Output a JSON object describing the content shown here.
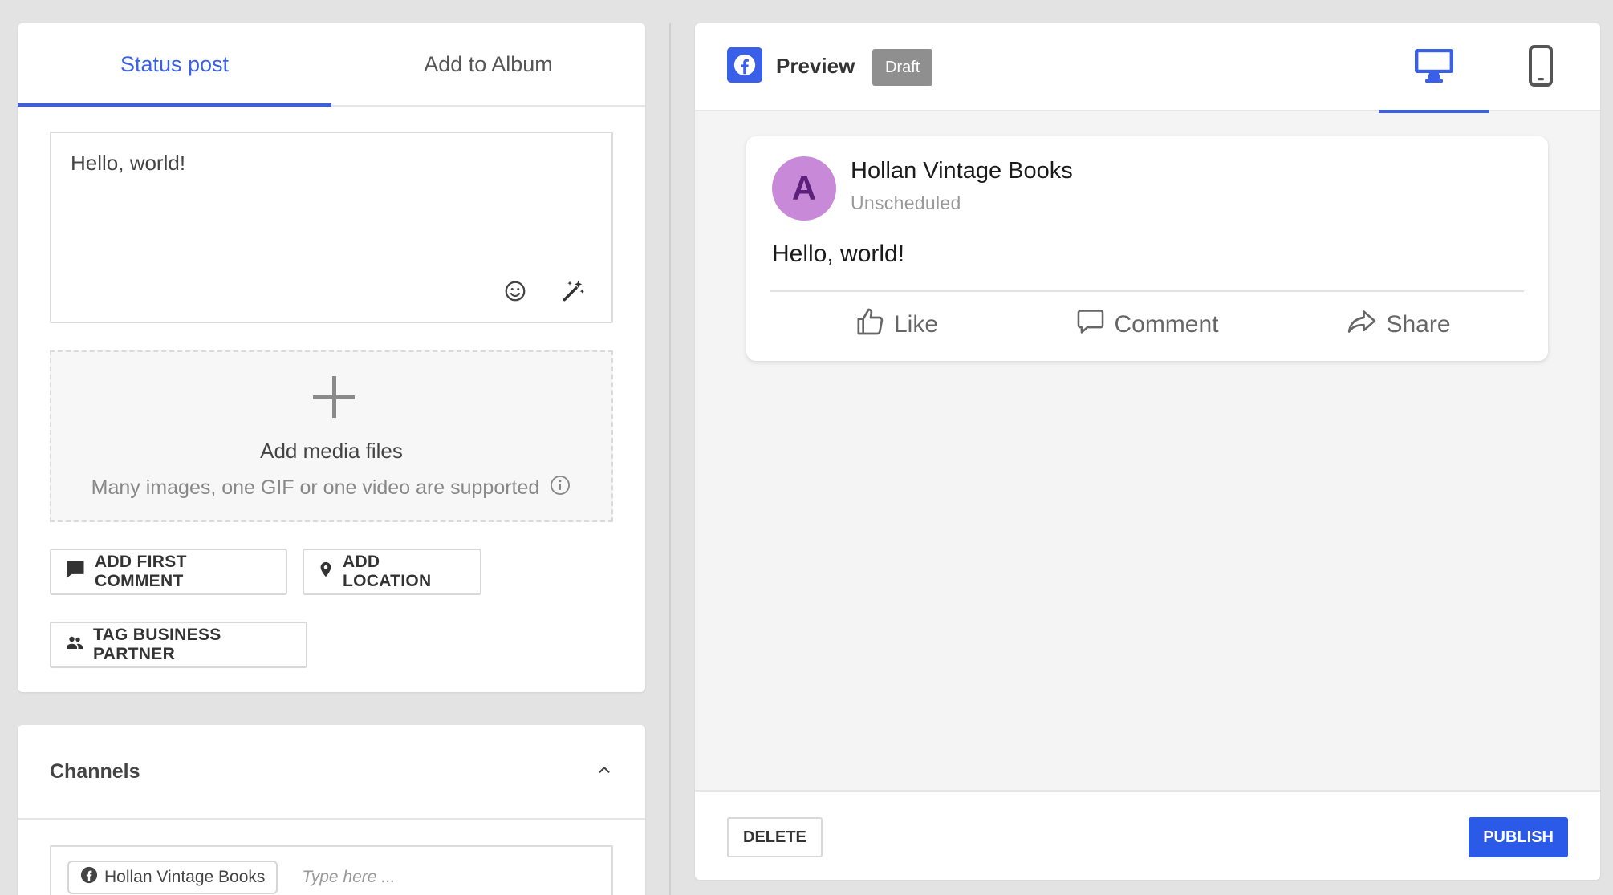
{
  "editor": {
    "tabs": [
      {
        "label": "Status post",
        "active": true
      },
      {
        "label": "Add to Album",
        "active": false
      }
    ],
    "message": "Hello, world!",
    "dropzone": {
      "title": "Add media files",
      "subtitle": "Many images, one GIF or one video are supported"
    },
    "buttons": {
      "first_comment": "ADD FIRST COMMENT",
      "location": "ADD LOCATION",
      "tag_partner": "TAG BUSINESS PARTNER"
    },
    "icons": [
      "emoji-icon",
      "magic-wand-icon",
      "plus-icon",
      "info-icon",
      "comment-icon",
      "location-pin-icon",
      "people-icon"
    ]
  },
  "channels": {
    "title": "Channels",
    "selected": "Hollan Vintage Books",
    "placeholder": "Type here ..."
  },
  "preview": {
    "title": "Preview",
    "badge": "Draft",
    "network": "facebook",
    "device_tabs": [
      {
        "icon": "desktop-icon",
        "active": true
      },
      {
        "icon": "mobile-icon",
        "active": false
      }
    ],
    "post": {
      "avatar_letter": "A",
      "page_name": "Hollan Vintage Books",
      "schedule": "Unscheduled",
      "text": "Hello, world!",
      "actions": {
        "like": "Like",
        "comment": "Comment",
        "share": "Share"
      }
    },
    "footer": {
      "delete_label": "DELETE",
      "publish_label": "PUBLISH"
    }
  },
  "colors": {
    "accent": "#3a5fe8",
    "publish": "#2b5ae8",
    "draft_badge": "#8f8f8f",
    "avatar_bg": "#c88ad8",
    "avatar_fg": "#5c1f7a",
    "page_bg": "#e3e3e3"
  }
}
